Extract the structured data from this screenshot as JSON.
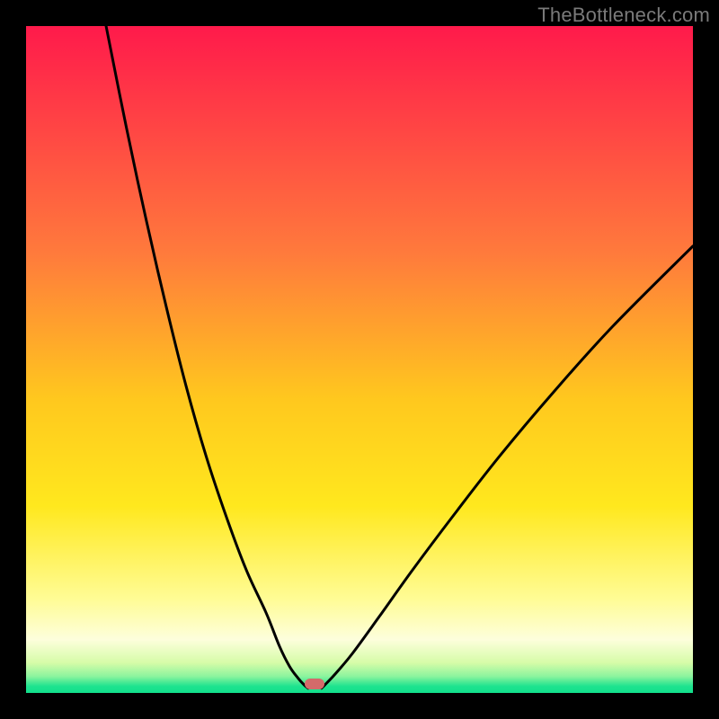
{
  "watermark": "TheBottleneck.com",
  "chart_data": {
    "type": "line",
    "title": "",
    "xlabel": "",
    "ylabel": "",
    "xlim": [
      0,
      100
    ],
    "ylim": [
      0,
      100
    ],
    "gradient_stops": [
      {
        "pos": 0.0,
        "color": "#ff1a4b"
      },
      {
        "pos": 0.34,
        "color": "#ff7a3c"
      },
      {
        "pos": 0.56,
        "color": "#ffc81e"
      },
      {
        "pos": 0.72,
        "color": "#ffe81e"
      },
      {
        "pos": 0.86,
        "color": "#fffc96"
      },
      {
        "pos": 0.92,
        "color": "#fdfedc"
      },
      {
        "pos": 0.955,
        "color": "#d6fca8"
      },
      {
        "pos": 0.975,
        "color": "#8cf49e"
      },
      {
        "pos": 0.99,
        "color": "#1ee38f"
      },
      {
        "pos": 1.0,
        "color": "#12e08c"
      }
    ],
    "series": [
      {
        "name": "left-branch",
        "x": [
          12.0,
          15.0,
          18.0,
          21.0,
          24.0,
          27.0,
          30.0,
          33.0,
          36.0,
          38.0,
          39.5,
          40.8,
          41.7,
          42.3
        ],
        "y": [
          100.0,
          85.0,
          71.0,
          58.0,
          46.0,
          35.5,
          26.5,
          18.5,
          12.0,
          7.0,
          4.0,
          2.2,
          1.2,
          0.7
        ]
      },
      {
        "name": "right-branch",
        "x": [
          44.3,
          45.0,
          46.5,
          49.0,
          53.0,
          58.0,
          64.0,
          71.0,
          79.0,
          88.0,
          100.0
        ],
        "y": [
          0.7,
          1.4,
          3.0,
          6.0,
          11.5,
          18.5,
          26.5,
          35.5,
          45.0,
          55.0,
          67.0
        ]
      }
    ],
    "marker": {
      "x_center": 43.3,
      "width_pct": 3.0,
      "y_bottom_pct": 0.6,
      "height_pct": 1.6,
      "color": "#d46a6a"
    }
  }
}
